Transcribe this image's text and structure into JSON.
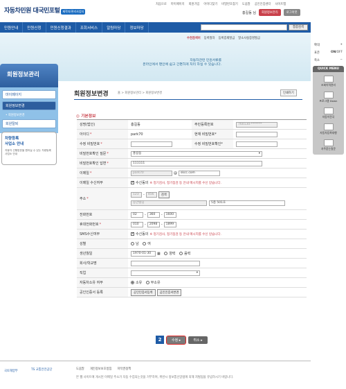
{
  "header": {
    "logo_text": "자동차민원 대국민포털",
    "logo_badge": "제작자/관리사업지",
    "top_links": [
      "처음으로",
      "마이페이지",
      "회원가입",
      "아이디찾기",
      "비밀번호찾기",
      "도움말",
      "공인인증센터",
      "사이트맵"
    ],
    "user_name": "홍길동 님",
    "member_info_btn": "회원정보관리",
    "logout_btn": "로그아웃"
  },
  "nav": {
    "items": [
      "민원안내",
      "민원신청",
      "민원신청결과",
      "조회서비스",
      "알림마당",
      "정보마당"
    ],
    "search_placeholder": "",
    "search_btn": "통합검색"
  },
  "subbar": {
    "label": "수천검색어",
    "items": [
      "등록절차",
      "등록증재발급",
      "말소사실증명발급"
    ]
  },
  "banner": {
    "text1": "자동차관련 민원서류를",
    "text2": "온라인에서 편안에 쉽고 간편하게 처리 하실 수 있습니다."
  },
  "right_panel": {
    "zoom_in": "확대",
    "zoom_default": "표준",
    "zoom_out": "축소",
    "onoff_on": "ON",
    "onoff_off": "OFF",
    "quick_menu_title": "QUICK MENU",
    "quick_items": [
      "조회이력관리",
      "프로그램 Down",
      "자동이전국",
      "자동차등록대행",
      "자주묻는질문"
    ]
  },
  "left_sidebar": {
    "title": "회원정보관리",
    "menu": [
      {
        "label": "마이페이지",
        "selected": false
      },
      {
        "label": "회원정보변경",
        "selected": true
      }
    ],
    "submenu": "회원정보변경",
    "withdraw": "회원탈퇴",
    "promo_title1": "차량등록",
    "promo_title2": "사업소 안내",
    "promo_desc": "자동차 선행방문을 원하실 수 있는 차량등록사업소 안내"
  },
  "main": {
    "page_title": "회원정보변경",
    "breadcrumb": "홈 > 회원정보관리 > 회원정보변경",
    "print_btn": "인쇄하기",
    "section_title": "기본정보"
  },
  "form": {
    "name_label": "성명(법인)",
    "name_value": "홍길동",
    "rrn_label": "주민등록번호",
    "rrn_value": "760130-*******",
    "id_label": "아이디",
    "id_value": "park70",
    "cur_pw_label": "현재 비밀번호",
    "new_pw_label": "수정 비밀번호",
    "new_pw_confirm_label": "수정 비밀번호확인",
    "pw_q_label": "비밀번호확인 질문",
    "pw_q_value": "홍길동",
    "pw_a_label": "비밀번호확인 답변",
    "pw_a_value": "111111",
    "email_label": "이메일",
    "email_id": "park70",
    "email_domain": "skcc.com",
    "email_recv_label": "이메일 수신여부",
    "email_recv_check": "수신동의",
    "email_recv_note": "※ 정기검사, 정기점검 등 안내 메시지를 수신 받습니다.",
    "address_label": "주소",
    "zip1": "123",
    "zip2": "456",
    "zip_btn": "검색",
    "addr1": "동안빌딩",
    "addr2": "5층 501호",
    "phone_label": "전화번호",
    "phone": [
      "02",
      "360",
      "1600"
    ],
    "mobile_label": "휴대전화번호",
    "mobile": [
      "010",
      "2098",
      "1899"
    ],
    "sms_label": "SMS수신여부",
    "sms_check": "수신동의",
    "sms_note": "※ 정기검사, 정기점검 등 안내 메시지를 수신 받습니다.",
    "gender_label": "성별",
    "gender_options": [
      "남",
      "여"
    ],
    "birth_label": "생년월일",
    "birth_value": "1970-01-30",
    "calendar_options": [
      "양력",
      "음력"
    ],
    "company_label": "회사/학교명",
    "job_label": "직업",
    "car_label": "자동차소유 여부",
    "car_options": [
      "소유",
      "무소유"
    ],
    "cert_label": "공인인증서 등록",
    "cert_btn1": "공인인증서등록",
    "cert_btn2": "공인인증서변경"
  },
  "buttons": {
    "step": "2",
    "save": "수정",
    "cancel": "취소"
  },
  "footer": {
    "logo1": "국토해양부",
    "logo2": "TS 교통안전공단",
    "links": [
      "도움말",
      "개인정보보호방침",
      "저작권정책"
    ],
    "copyright": "본 웹 사이트에 게시된 이메일 주소가 자동 수집되는것을 거부하며, 위반시 정보통신망법에 의해 처벌됨을 유념하시기 바랍니다."
  }
}
